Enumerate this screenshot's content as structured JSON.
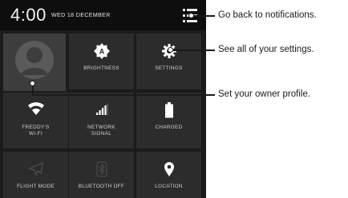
{
  "status_bar": {
    "time": "4:00",
    "date": "WED 18 DECEMBER"
  },
  "tiles": {
    "brightness": {
      "label": "BRIGHTNESS",
      "icon": "brightness-auto-icon"
    },
    "settings": {
      "label": "SETTINGS",
      "icon": "gear-icon"
    },
    "wifi": {
      "label": "FREDDY'S\nWI-FI",
      "icon": "wifi-icon"
    },
    "network": {
      "label": "NETWORK\nSIGNAL",
      "icon": "signal-icon"
    },
    "battery": {
      "label": "CHARGED",
      "icon": "battery-icon"
    },
    "flight": {
      "label": "FLIGHT MODE",
      "icon": "airplane-icon"
    },
    "bluetooth": {
      "label": "BLUETOOTH OFF",
      "icon": "bluetooth-icon"
    },
    "location": {
      "label": "LOCATION",
      "icon": "location-pin-icon"
    }
  },
  "callouts": {
    "notifications": "Go back to notifications.",
    "settings": "See all of your settings.",
    "profile": "Set your owner profile."
  },
  "colors": {
    "panel": "#1b1b1b",
    "tile": "#2c2c2c",
    "profile_tile": "#3d3d3d",
    "status_bar": "#0e0e0e"
  }
}
